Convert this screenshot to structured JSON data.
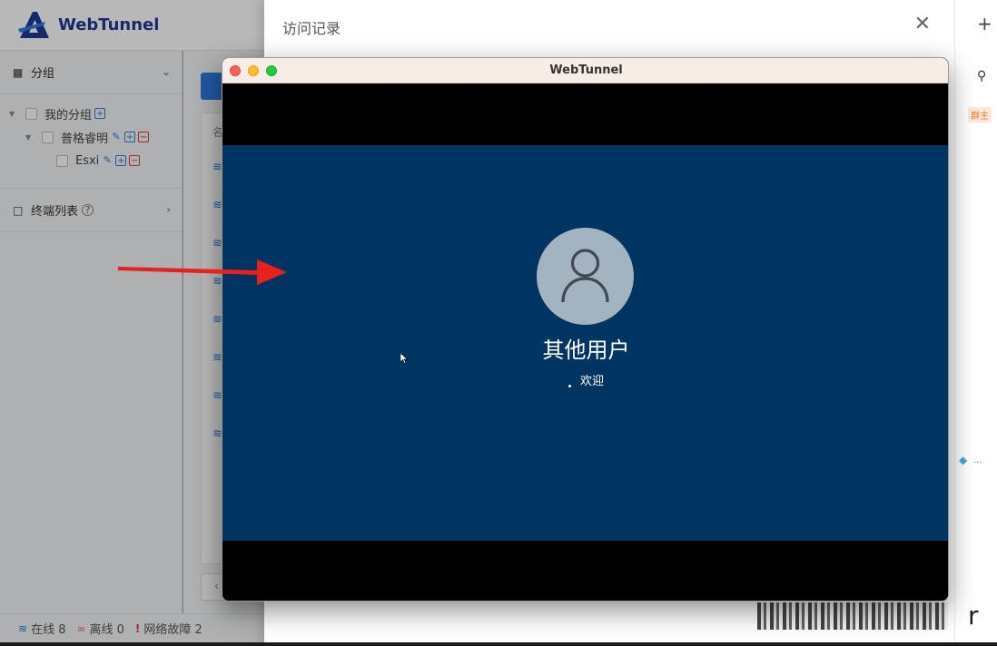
{
  "app": {
    "brand": "WebTunnel",
    "accent_color": "#2d7be0"
  },
  "sidebar": {
    "group_section": {
      "label": "分组",
      "icon": "sitemap-icon"
    },
    "tree": [
      {
        "label": "我的分组",
        "level": 0,
        "actions": [
          "add"
        ]
      },
      {
        "label": "普格睿明",
        "level": 1,
        "actions": [
          "edit",
          "add",
          "delete"
        ]
      },
      {
        "label": "Esxi",
        "level": 2,
        "actions": [
          "edit",
          "add",
          "delete"
        ]
      }
    ],
    "terminal_section": {
      "label": "终端列表",
      "icon": "monitor-icon",
      "help_icon": "question-circle-icon"
    }
  },
  "content": {
    "table_header_partial": "名"
  },
  "statusbar": {
    "online": "在线 8",
    "offline": "离线 0",
    "fault": "网络故障 2"
  },
  "drawer": {
    "title": "访问记录",
    "close_icon": "close-icon"
  },
  "right_strip": {
    "badge": "群主",
    "ellipsis": "..."
  },
  "mac_window": {
    "title": "WebTunnel",
    "login_screen": {
      "user_name": "其他用户",
      "status_text": "欢迎",
      "background_color": "#003562"
    }
  },
  "bottom_strip": {
    "letter": "r"
  }
}
